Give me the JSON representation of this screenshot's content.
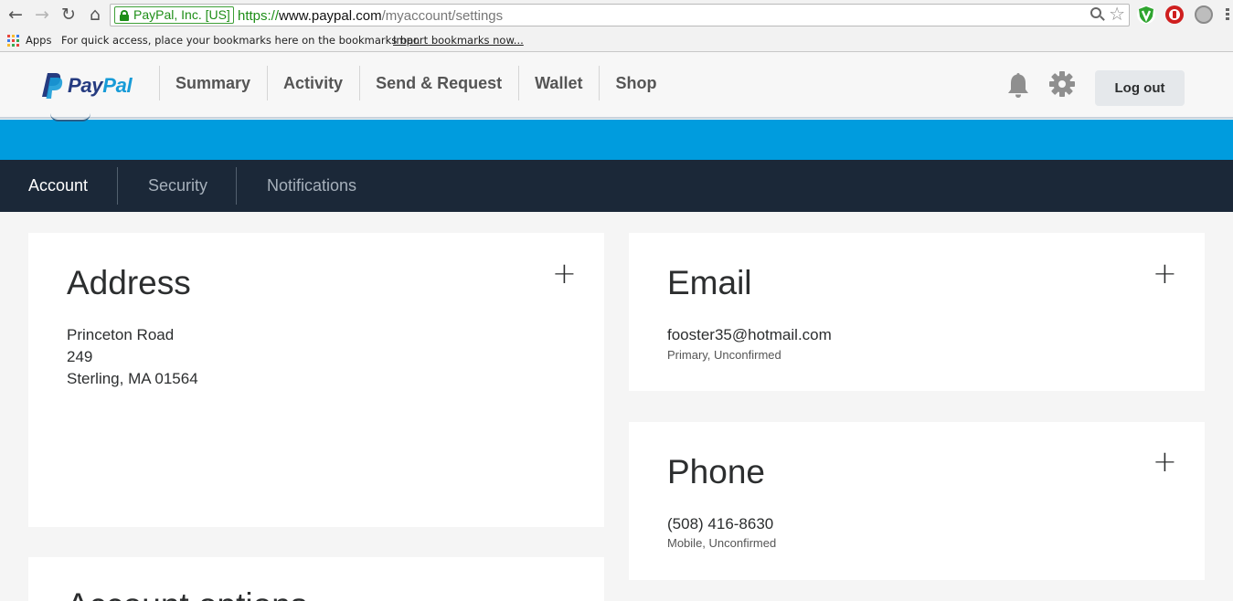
{
  "browser": {
    "security_badge": "PayPal, Inc. [US]",
    "url_scheme": "https://",
    "url_host": "www.paypal.com",
    "url_path": "/myaccount/settings",
    "bookmarks": {
      "apps_label": "Apps",
      "hint": "For quick access, place your bookmarks here on the bookmarks bar.",
      "import_link": "Import bookmarks now..."
    }
  },
  "header": {
    "logo_pay": "Pay",
    "logo_pal": "Pal",
    "nav": [
      "Summary",
      "Activity",
      "Send & Request",
      "Wallet",
      "Shop"
    ],
    "logout_label": "Log out"
  },
  "tabs": {
    "account": "Account",
    "security": "Security",
    "notifications": "Notifications"
  },
  "address": {
    "title": "Address",
    "add_symbol": "+",
    "line1": "Princeton Road",
    "line2": "249",
    "line3": "Sterling, MA 01564"
  },
  "email": {
    "title": "Email",
    "add_symbol": "+",
    "value": "fooster35@hotmail.com",
    "status": "Primary, Unconfirmed"
  },
  "phone": {
    "title": "Phone",
    "add_symbol": "+",
    "value": "(508) 416-8630",
    "status": "Mobile, Unconfirmed"
  },
  "account_options": {
    "title": "Account options"
  },
  "colors": {
    "paypal_dark_blue": "#253b80",
    "paypal_light_blue": "#179bd7",
    "banner_blue": "#009cde",
    "tab_bar_navy": "#1b2838",
    "secure_green": "#1e8e17"
  },
  "icons": [
    "back-arrow-icon",
    "forward-arrow-icon",
    "reload-icon",
    "home-icon",
    "lock-icon",
    "zoom-icon",
    "star-icon",
    "shield-extension-icon",
    "stop-extension-icon",
    "globe-extension-icon",
    "menu-icon",
    "apps-icon",
    "bell-icon",
    "gear-icon",
    "plus-icon"
  ]
}
